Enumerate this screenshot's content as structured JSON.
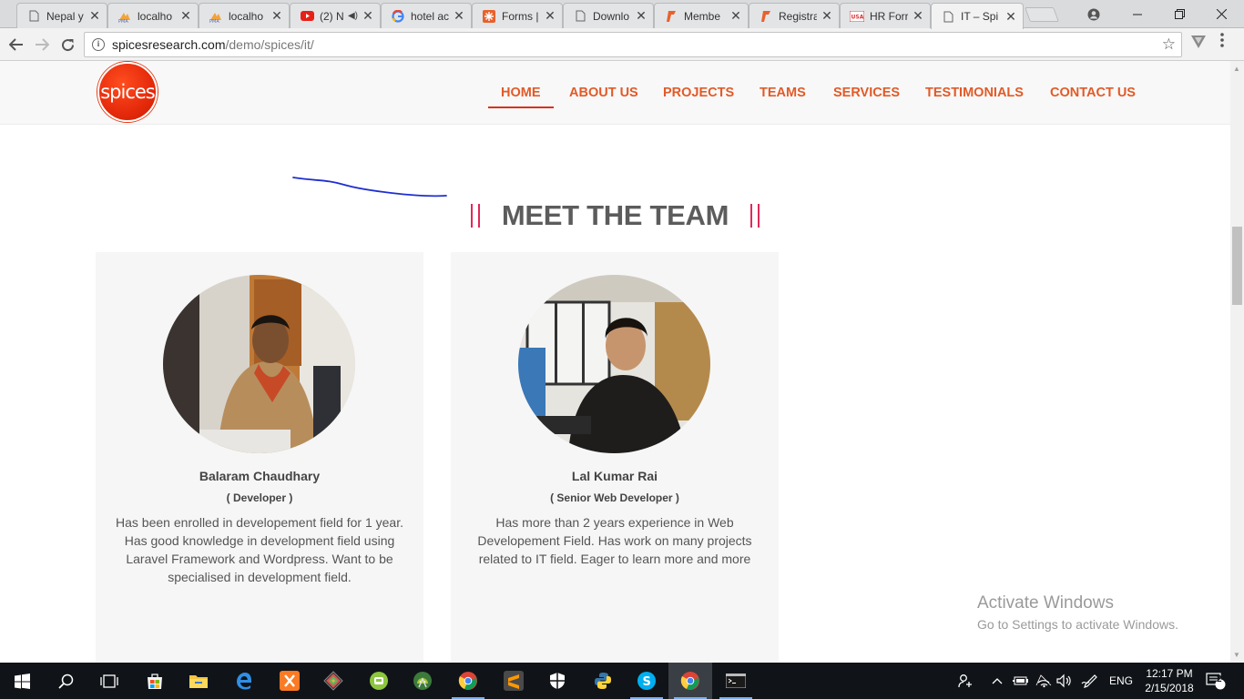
{
  "browser": {
    "tabs": [
      {
        "title": "Nepal y",
        "icon": "document-icon"
      },
      {
        "title": "localho",
        "icon": "phpmyadmin-icon"
      },
      {
        "title": "localho",
        "icon": "phpmyadmin-icon"
      },
      {
        "title": "(2) N",
        "icon": "youtube-icon"
      },
      {
        "title": "hotel ac",
        "icon": "google-icon"
      },
      {
        "title": "Forms |",
        "icon": "forms-icon"
      },
      {
        "title": "Downlo",
        "icon": "document-icon"
      },
      {
        "title": "Membe",
        "icon": "formidable-icon"
      },
      {
        "title": "Registra",
        "icon": "formidable-icon"
      },
      {
        "title": "HR Forr",
        "icon": "hr-form-icon"
      },
      {
        "title": "IT – Spi",
        "icon": "document-icon"
      }
    ],
    "url_host": "spicesresearch.com",
    "url_path": "/demo/spices/it/"
  },
  "site": {
    "logo_text": "spices",
    "nav": [
      "HOME",
      "ABOUT US",
      "PROJECTS",
      "TEAMS",
      "SERVICES",
      "TESTIMONIALS",
      "CONTACT US"
    ],
    "active_nav": "HOME"
  },
  "team": {
    "heading": "MEET THE TEAM",
    "members": [
      {
        "name": "Balaram Chaudhary",
        "role": "( Developer )",
        "bio": "Has been enrolled in developement field for 1 year. Has good knowledge in development field using Laravel Framework and Wordpress. Want to be specialised in development field."
      },
      {
        "name": "Lal Kumar Rai",
        "role": "( Senior Web Developer )",
        "bio": "Has more than 2 years experience in Web Developement Field. Has work on many projects related to IT field. Eager to learn more and more"
      }
    ]
  },
  "watermark": {
    "line1": "Activate Windows",
    "line2": "Go to Settings to activate Windows."
  },
  "taskbar": {
    "language": "ENG",
    "time": "12:17 PM",
    "date": "2/15/2018",
    "notifications": "2"
  },
  "colors": {
    "accent": "#e25a27",
    "title_bar": "#e2285a"
  }
}
